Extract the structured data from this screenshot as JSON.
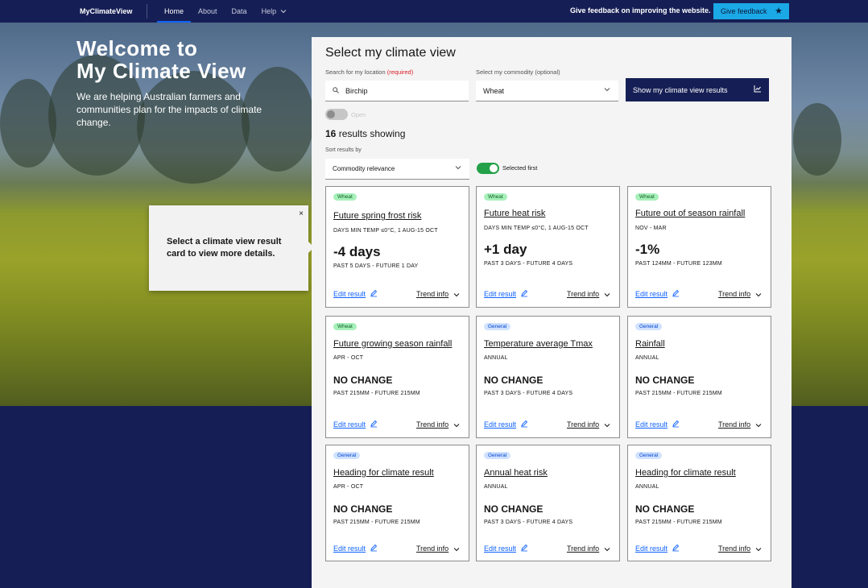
{
  "nav": {
    "brand": "MyClimateView",
    "items": [
      {
        "label": "Home",
        "active": true
      },
      {
        "label": "About",
        "active": false
      },
      {
        "label": "Data",
        "active": false
      },
      {
        "label": "Help",
        "active": false,
        "has_dropdown": true
      }
    ],
    "feedback_text": "Give feedback on improving the website.",
    "feedback_button": "Give feedback",
    "feedback_icon": "star-icon"
  },
  "hero": {
    "title_line1": "Welcome to",
    "title_line2": "My Climate View",
    "description": "We are helping Australian farmers and communities plan for the impacts of climate change."
  },
  "tooltip": {
    "text": "Select a climate view result card to view more details.",
    "close": "×"
  },
  "panel": {
    "title": "Select my climate view",
    "location_label": "Search for my location",
    "location_required": "(required)",
    "location_value": "Birchip",
    "commodity_label": "Select my commodity (optional)",
    "commodity_value": "Wheat",
    "show_button": "Show my climate view results",
    "open_toggle_label": "Open",
    "open_toggle_on": false,
    "results_count": "16",
    "results_text": "results showing",
    "sort_label": "Sort results by",
    "sort_value": "Commodity relevance",
    "selected_first_label": "Selected first",
    "selected_first_on": true
  },
  "card_actions": {
    "edit": "Edit result",
    "trend": "Trend info"
  },
  "cards": [
    {
      "badge": "Wheat",
      "badge_type": "wheat",
      "title": "Future spring frost risk",
      "sub": "DAYS MIN TEMP ≤0°C, 1 AUG-15 OCT",
      "value": "-4 days",
      "past": "PAST 5 DAYS - FUTURE 1 DAY"
    },
    {
      "badge": "Wheat",
      "badge_type": "wheat",
      "title": "Future heat risk",
      "sub": "DAYS MIN TEMP ≤0°C, 1 AUG-15 OCT",
      "value": "+1 day",
      "past": "PAST 3 DAYS - FUTURE 4 DAYS"
    },
    {
      "badge": "Wheat",
      "badge_type": "wheat",
      "title": "Future out of season rainfall",
      "sub": "NOV - MAR",
      "value": "-1%",
      "past": "PAST 124MM - FUTURE 123MM"
    },
    {
      "badge": "Wheat",
      "badge_type": "wheat",
      "title": "Future growing season rainfall",
      "sub": "APR - OCT",
      "value": "NO CHANGE",
      "past": "PAST 215MM - FUTURE 215MM"
    },
    {
      "badge": "General",
      "badge_type": "general",
      "title": "Temperature average Tmax",
      "sub": "ANNUAL",
      "value": "NO CHANGE",
      "past": "PAST 3 DAYS - FUTURE 4 DAYS"
    },
    {
      "badge": "General",
      "badge_type": "general",
      "title": "Rainfall",
      "sub": "ANNUAL",
      "value": "NO CHANGE",
      "past": "PAST 215MM - FUTURE 215MM"
    },
    {
      "badge": "General",
      "badge_type": "general",
      "title": "Heading for climate result",
      "sub": "APR - OCT",
      "value": "NO CHANGE",
      "past": "PAST 215MM - FUTURE 215MM"
    },
    {
      "badge": "General",
      "badge_type": "general",
      "title": "Annual heat risk",
      "sub": "ANNUAL",
      "value": "NO CHANGE",
      "past": "PAST 3 DAYS - FUTURE 4 DAYS"
    },
    {
      "badge": "General",
      "badge_type": "general",
      "title": "Heading for climate result",
      "sub": "ANNUAL",
      "value": "NO CHANGE",
      "past": "PAST 215MM - FUTURE 215MM"
    }
  ],
  "colors": {
    "navy": "#161f55",
    "link_blue": "#0f62fe",
    "feedback_cyan": "#1ba8e6",
    "toggle_green": "#24a148"
  }
}
